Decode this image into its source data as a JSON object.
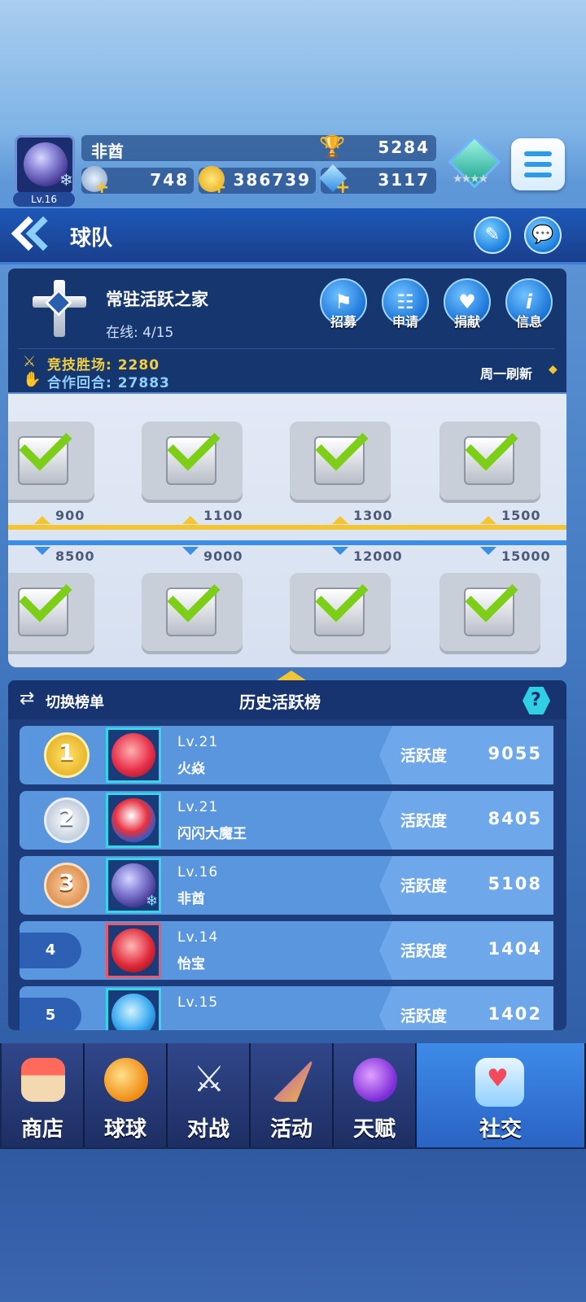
{
  "player": {
    "name": "非酋",
    "level": "Lv.16",
    "trophies": "5284",
    "energy": "748",
    "coins": "386739",
    "gems": "3117"
  },
  "header": {
    "title": "球队"
  },
  "team": {
    "name": "常驻活跃之家",
    "online": "在线: 4/15",
    "arena_wins": "竞技胜场: 2280",
    "coop_rounds": "合作回合: 27883",
    "refresh": "周一刷新",
    "buttons": [
      {
        "label": "招募"
      },
      {
        "label": "申请"
      },
      {
        "label": "捐献"
      },
      {
        "label": "信息"
      }
    ]
  },
  "rewards": {
    "top_thresholds": [
      "900",
      "1100",
      "1300",
      "1500"
    ],
    "bottom_thresholds": [
      "8500",
      "9000",
      "12000",
      "15000"
    ]
  },
  "ranking": {
    "switch_label": "切换榜单",
    "title": "历史活跃榜",
    "help": "?",
    "activity_label": "活跃度",
    "rows": [
      {
        "rank": "1",
        "level": "Lv.21",
        "name": "火焱",
        "activity": "9055"
      },
      {
        "rank": "2",
        "level": "Lv.21",
        "name": "闪闪大魔王",
        "activity": "8405"
      },
      {
        "rank": "3",
        "level": "Lv.16",
        "name": "非酋",
        "activity": "5108"
      },
      {
        "rank": "4",
        "level": "Lv.14",
        "name": "怡宝",
        "activity": "1404"
      },
      {
        "rank": "5",
        "level": "Lv.15",
        "name": "",
        "activity": "1402"
      }
    ]
  },
  "nav": {
    "tabs": [
      {
        "label": "商店"
      },
      {
        "label": "球球"
      },
      {
        "label": "对战"
      },
      {
        "label": "活动"
      },
      {
        "label": "天赋"
      },
      {
        "label": "社交"
      }
    ]
  },
  "colors": {
    "accent": "#1a7fe0",
    "gold": "#f3c531",
    "check": "#7ccf16",
    "panel": "#16366f"
  }
}
